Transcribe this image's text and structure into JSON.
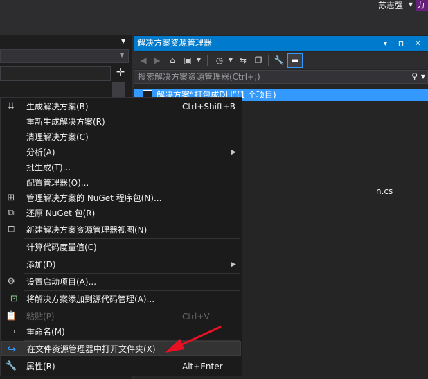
{
  "user": {
    "name": "苏志强",
    "badge": "力"
  },
  "solution_explorer": {
    "title": "解决方案资源管理器",
    "search_placeholder": "搜索解决方案资源管理器(Ctrl+;)",
    "tree_root": "解决方案“打包成DLL”(1 个项目)",
    "partial_file": "n.cs",
    "title_buttons": "▾ ⊓ ✕"
  },
  "context_menu": {
    "items": [
      {
        "label": "生成解决方案(B)",
        "shortcut": "Ctrl+Shift+B",
        "icon": "build-icon"
      },
      {
        "label": "重新生成解决方案(R)",
        "shortcut": "",
        "icon": ""
      },
      {
        "label": "清理解决方案(C)",
        "shortcut": "",
        "icon": ""
      },
      {
        "label": "分析(A)",
        "shortcut": "",
        "icon": "",
        "submenu": true
      },
      {
        "label": "批生成(T)...",
        "shortcut": "",
        "icon": ""
      },
      {
        "label": "配置管理器(O)...",
        "shortcut": "",
        "icon": ""
      },
      {
        "label": "管理解决方案的 NuGet 程序包(N)...",
        "shortcut": "",
        "icon": "nuget-package-icon"
      },
      {
        "label": "还原 NuGet 包(R)",
        "shortcut": "",
        "icon": "restore-package-icon"
      },
      {
        "label": "新建解决方案资源管理器视图(N)",
        "shortcut": "",
        "icon": "new-view-icon"
      },
      {
        "label": "计算代码度量值(C)",
        "shortcut": "",
        "icon": ""
      },
      {
        "label": "添加(D)",
        "shortcut": "",
        "icon": "",
        "submenu": true
      },
      {
        "label": "设置启动项目(A)...",
        "shortcut": "",
        "icon": "gear-icon"
      },
      {
        "label": "将解决方案添加到源代码管理(A)...",
        "shortcut": "",
        "icon": "add-source-control-icon"
      },
      {
        "label": "粘贴(P)",
        "shortcut": "Ctrl+V",
        "icon": "paste-icon",
        "disabled": true
      },
      {
        "label": "重命名(M)",
        "shortcut": "",
        "icon": "rename-icon"
      },
      {
        "label": "在文件资源管理器中打开文件夹(X)",
        "shortcut": "",
        "icon": "open-folder-icon",
        "highlighted": true
      },
      {
        "label": "属性(R)",
        "shortcut": "Alt+Enter",
        "icon": "wrench-icon"
      }
    ],
    "submenu_arrow": "▶"
  },
  "colors": {
    "accent": "#007acc",
    "selection": "#3399ff",
    "annotation_arrow": "#e81123"
  }
}
